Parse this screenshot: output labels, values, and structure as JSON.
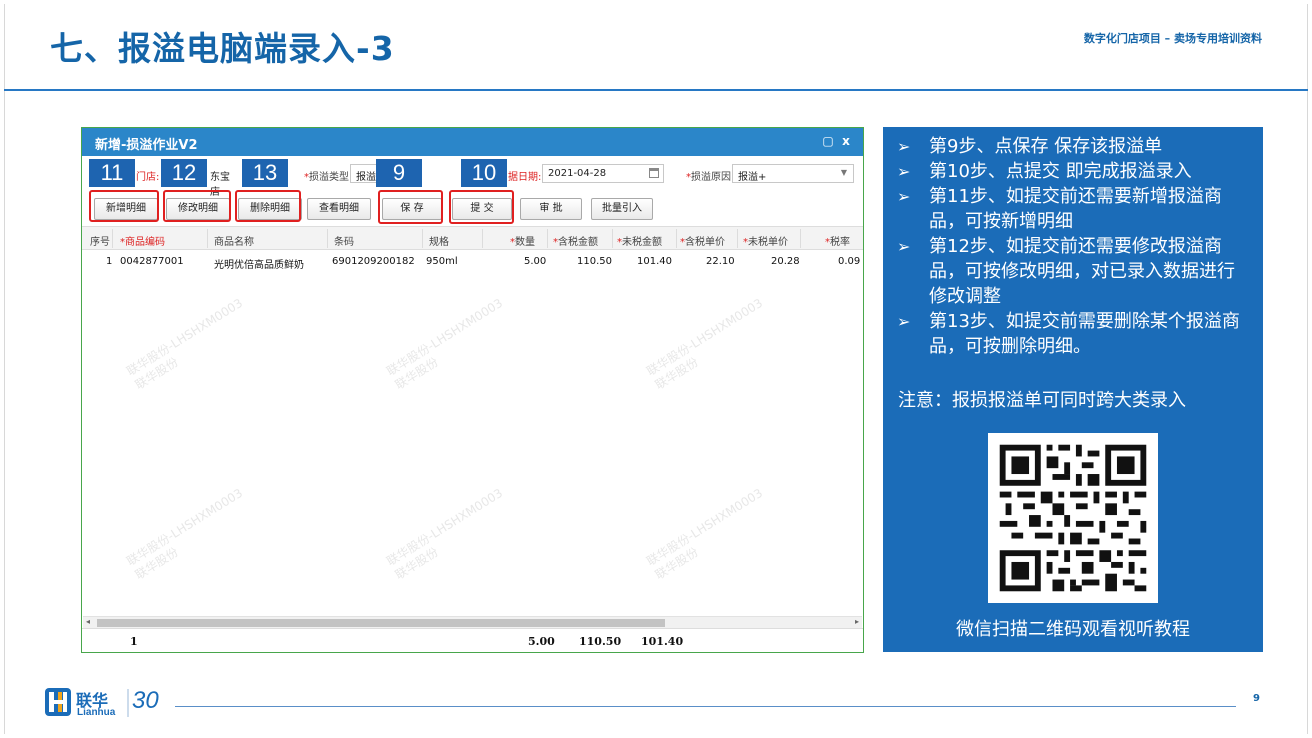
{
  "slide": {
    "title": "七、报溢电脑端录入-3",
    "subtitle": "数字化门店项目 – 卖场专用培训资料",
    "page_number": "9"
  },
  "app": {
    "window_title": "新增-损溢作业V2",
    "restore_glyph": "▢",
    "close_glyph": "x",
    "form": {
      "store_label": "门店:",
      "store_value": "东宝店",
      "type_label": "损溢类型:",
      "type_value": "报溢",
      "date_label": "据日期:",
      "date_value": "2021-04-28",
      "reason_label": "损溢原因:",
      "reason_value": "报溢+"
    },
    "toolbar": {
      "add_detail": "新增明细",
      "edit_detail": "修改明细",
      "delete_detail": "删除明细",
      "view_detail": "查看明细",
      "save": "保 存",
      "submit": "提 交",
      "approve": "审 批",
      "batch_import": "批量引入"
    },
    "grid": {
      "columns": [
        "序号",
        "商品编码",
        "商品名称",
        "条码",
        "规格",
        "数量",
        "含税金额",
        "未税金额",
        "含税单价",
        "未税单价",
        "税率"
      ],
      "rows": [
        [
          "1",
          "0042877001",
          "光明优倍高品质鲜奶",
          "6901209200182",
          "950ml",
          "5.00",
          "110.50",
          "101.40",
          "22.10",
          "20.28",
          "0.09"
        ]
      ]
    },
    "totals": {
      "count": "1",
      "qty": "5.00",
      "tax_amount": "110.50",
      "net_amount": "101.40"
    },
    "scroll_left": "◂",
    "scroll_right": "▸",
    "watermark_text": "联华股份-LHSHXM0003\n联华股份"
  },
  "callouts": {
    "step_11": "11",
    "step_12": "12",
    "step_13": "13",
    "step_9": "9",
    "step_10": "10"
  },
  "panel": {
    "bullet_glyph": "➢",
    "bullets": [
      "第9步、点保存 保存该报溢单",
      "第10步、点提交 即完成报溢录入",
      "第11步、如提交前还需要新增报溢商品，可按新增明细",
      "第12步、如提交前还需要修改报溢商品，可按修改明细，对已录入数据进行修改调整",
      "第13步、如提交前需要删除某个报溢商品，可按删除明细。"
    ],
    "note": "注意：报损报溢单可同时跨大类录入",
    "qr_caption": "微信扫描二维码观看视听教程"
  },
  "logo": {
    "brand_cn": "联华",
    "brand_en": "Lianhua",
    "anniversary": "30"
  },
  "colors": {
    "title_blue": "#1565a8",
    "app_titlebar": "#2b86c9",
    "panel_blue": "#1b6cb8",
    "callout_blue": "#1e64b0",
    "highlight_red": "#e02020",
    "window_border_green": "#48a64b"
  }
}
